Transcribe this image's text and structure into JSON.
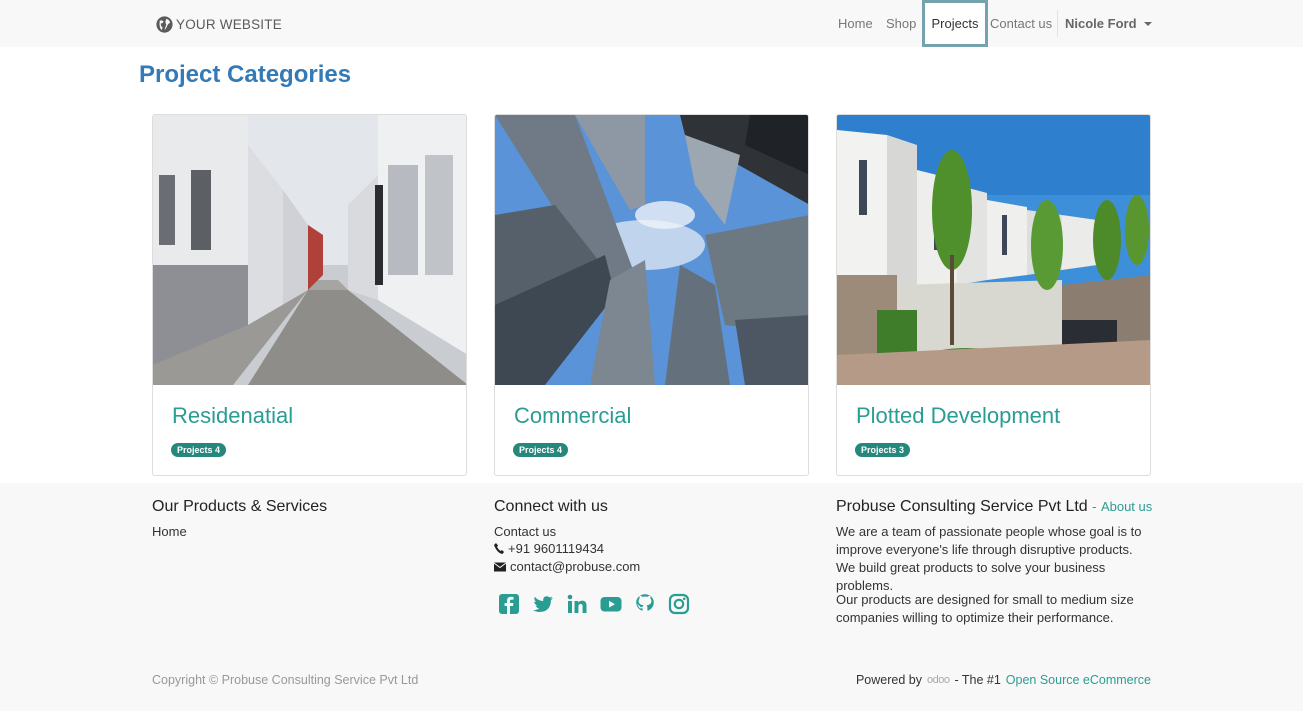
{
  "header": {
    "brand": "YOUR WEBSITE",
    "nav": [
      "Home",
      "Shop",
      "Projects",
      "Contact us"
    ],
    "user": "Nicole Ford"
  },
  "main": {
    "title": "Project Categories",
    "cards": [
      {
        "title": "Residenatial",
        "badge": "Projects 4"
      },
      {
        "title": "Commercial",
        "badge": "Projects 4"
      },
      {
        "title": "Plotted Development",
        "badge": "Projects 3"
      }
    ]
  },
  "footer": {
    "products": {
      "heading": "Our Products & Services",
      "link": "Home"
    },
    "connect": {
      "heading": "Connect with us",
      "contact_link": "Contact us",
      "phone": "+91 9601119434",
      "email": "contact@probuse.com",
      "social_icons": [
        "facebook-icon",
        "twitter-icon",
        "linkedin-icon",
        "youtube-icon",
        "github-icon",
        "instagram-icon"
      ]
    },
    "company": {
      "heading": "Probuse Consulting Service Pvt Ltd",
      "sep": "-",
      "about": "About us",
      "p1": "We are a team of passionate people whose goal is to improve everyone's life through disruptive products. We build great products to solve your business problems.",
      "p2": "Our products are designed for small to medium size companies willing to optimize their performance."
    },
    "copyright": "Copyright © Probuse Consulting Service Pvt Ltd",
    "powered": {
      "prefix": "Powered by",
      "logo": "odoo",
      "middle": "- The #1",
      "link": "Open Source eCommerce"
    }
  },
  "colors": {
    "accent": "#2a9d93",
    "title_blue": "#337ab7",
    "badge": "#26887c",
    "active_border": "#74a3ad"
  }
}
